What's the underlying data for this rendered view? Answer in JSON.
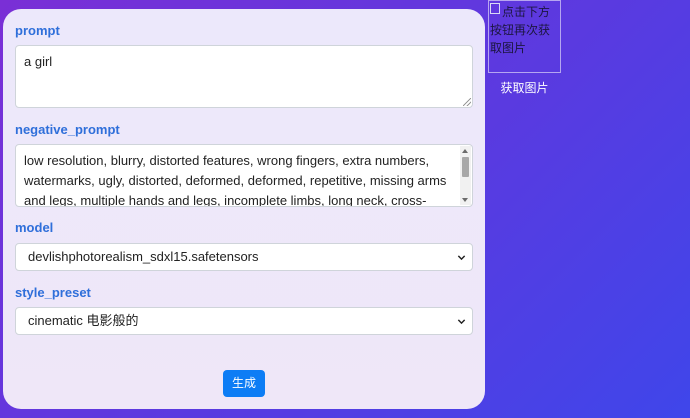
{
  "form": {
    "prompt": {
      "label": "prompt",
      "value": "a girl"
    },
    "negative_prompt": {
      "label": "negative_prompt",
      "value": "low resolution, blurry, distorted features, wrong fingers, extra numbers, watermarks, ugly, distorted, deformed, deformed, repetitive, missing arms and legs, multiple hands and legs, incomplete limbs, long neck, cross-eyed, glassy eyes, lens, extra belly, deformed"
    },
    "model": {
      "label": "model",
      "selected": "devlishphotorealism_sdxl15.safetensors"
    },
    "style_preset": {
      "label": "style_preset",
      "selected": "cinematic 电影般的"
    },
    "generate_label": "生成"
  },
  "preview": {
    "alt_text": "点击下方按钮再次获取图片",
    "get_image_label": "获取图片"
  },
  "colors": {
    "label_blue": "#2f6fda",
    "button_blue": "#0d7df5"
  }
}
